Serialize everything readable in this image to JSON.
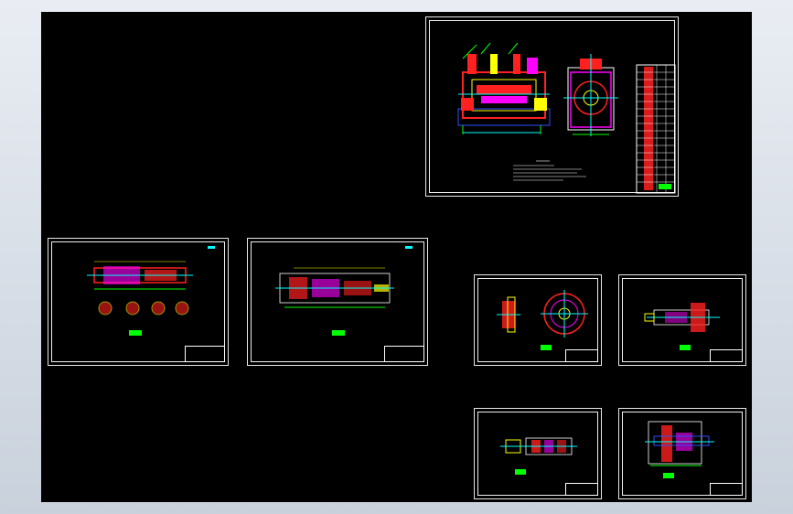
{
  "colors": {
    "canvas": "#000000",
    "frame": "#ffffff",
    "red": "#ff2020",
    "yellow": "#ffff00",
    "cyan": "#00ffff",
    "green": "#00ff00",
    "magenta": "#ff00ff",
    "blue": "#3050ff"
  },
  "sheets": [
    {
      "id": "assembly-drawing",
      "kind": "assembly"
    },
    {
      "id": "shaft-drawing-1",
      "kind": "shaft-with-sections"
    },
    {
      "id": "shaft-drawing-2",
      "kind": "stepped-shaft"
    },
    {
      "id": "gear-drawing",
      "kind": "gear"
    },
    {
      "id": "gear-shaft-drawing",
      "kind": "gear-shaft"
    },
    {
      "id": "small-shaft-drawing",
      "kind": "small-shaft"
    },
    {
      "id": "housing-drawing",
      "kind": "housing"
    }
  ]
}
